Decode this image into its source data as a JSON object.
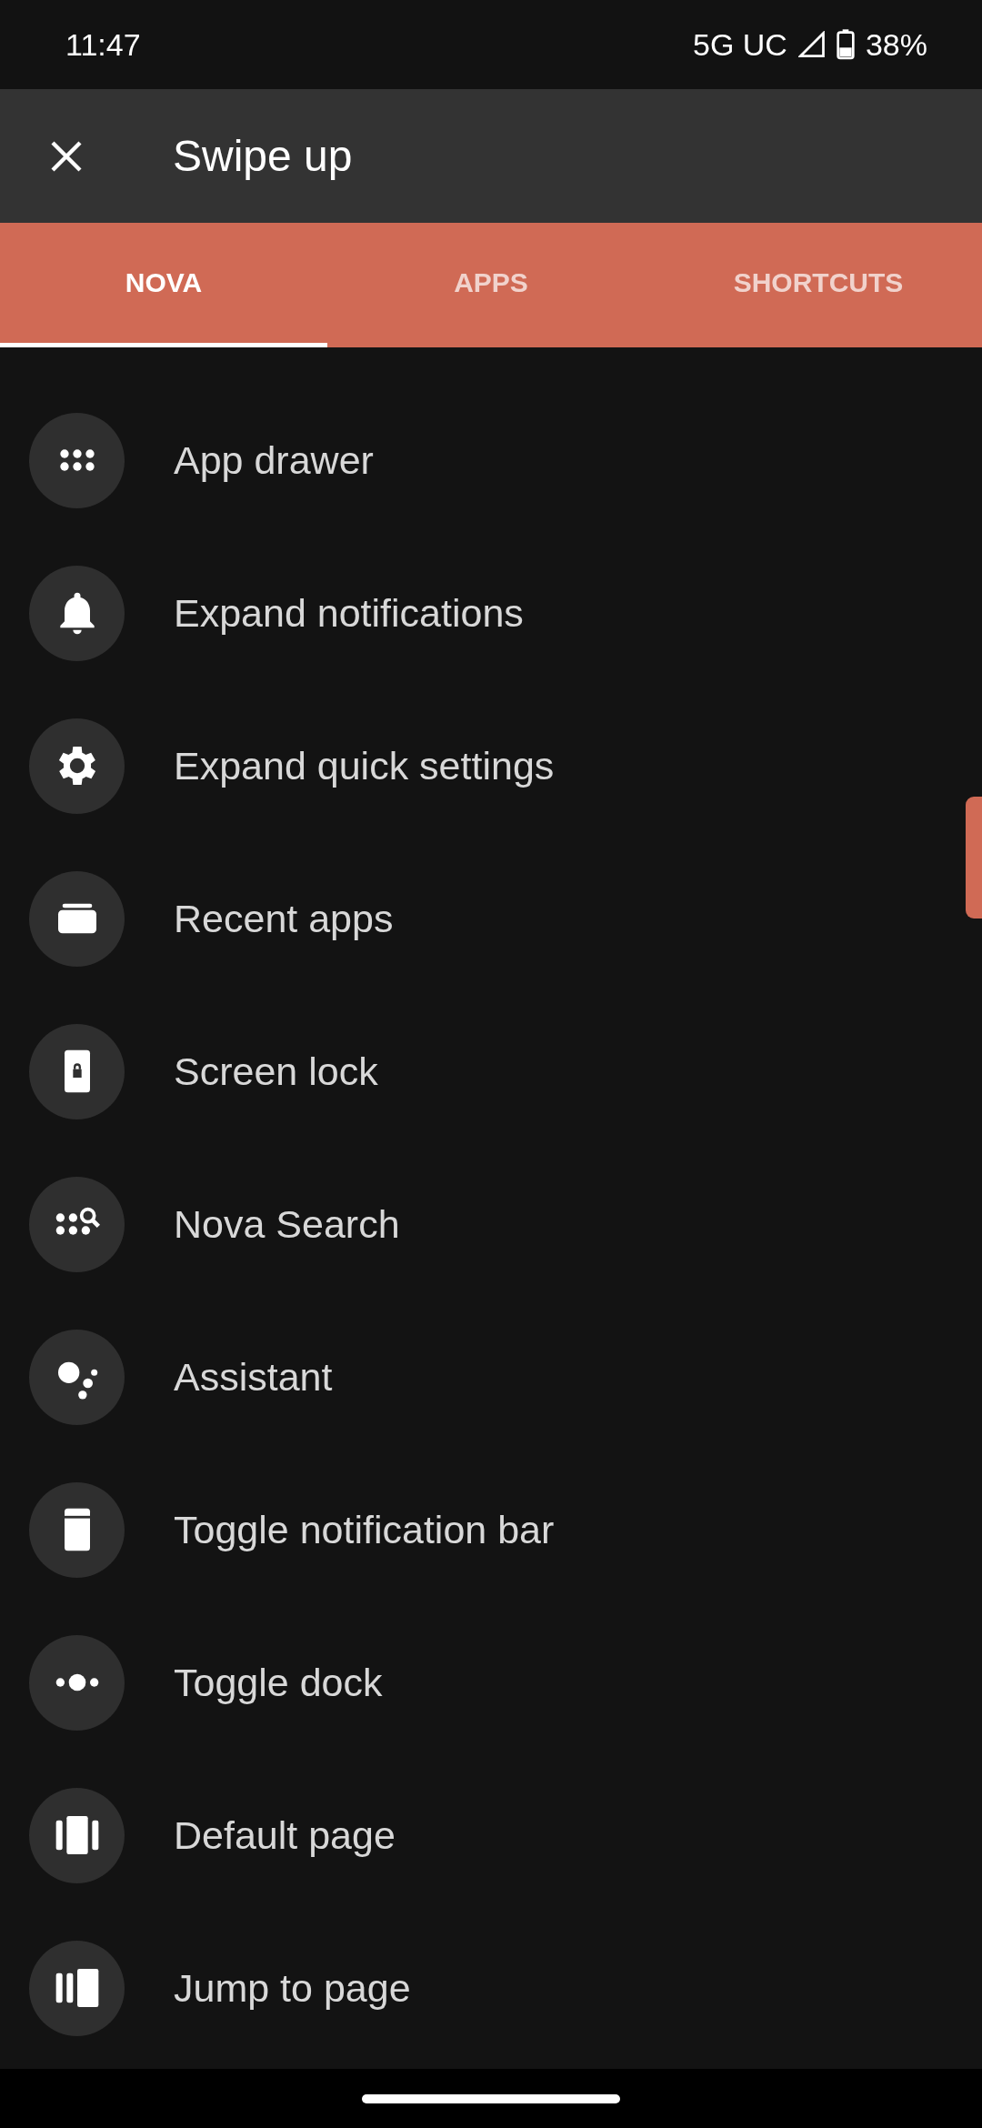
{
  "status_bar": {
    "time": "11:47",
    "network": "5G UC",
    "battery": "38%"
  },
  "app_bar": {
    "title": "Swipe up"
  },
  "tabs": [
    {
      "label": "NOVA",
      "selected": true
    },
    {
      "label": "APPS",
      "selected": false
    },
    {
      "label": "SHORTCUTS",
      "selected": false
    }
  ],
  "items": [
    {
      "label": "App drawer",
      "kind": "drawer"
    },
    {
      "label": "Expand notifications",
      "kind": "bell"
    },
    {
      "label": "Expand quick settings",
      "kind": "gear"
    },
    {
      "label": "Recent apps",
      "kind": "recents"
    },
    {
      "label": "Screen lock",
      "kind": "lock"
    },
    {
      "label": "Nova Search",
      "kind": "search"
    },
    {
      "label": "Assistant",
      "kind": "assistant"
    },
    {
      "label": "Toggle notification bar",
      "kind": "notifbar"
    },
    {
      "label": "Toggle dock",
      "kind": "dock"
    },
    {
      "label": "Default page",
      "kind": "page"
    },
    {
      "label": "Jump to page",
      "kind": "jump"
    }
  ]
}
